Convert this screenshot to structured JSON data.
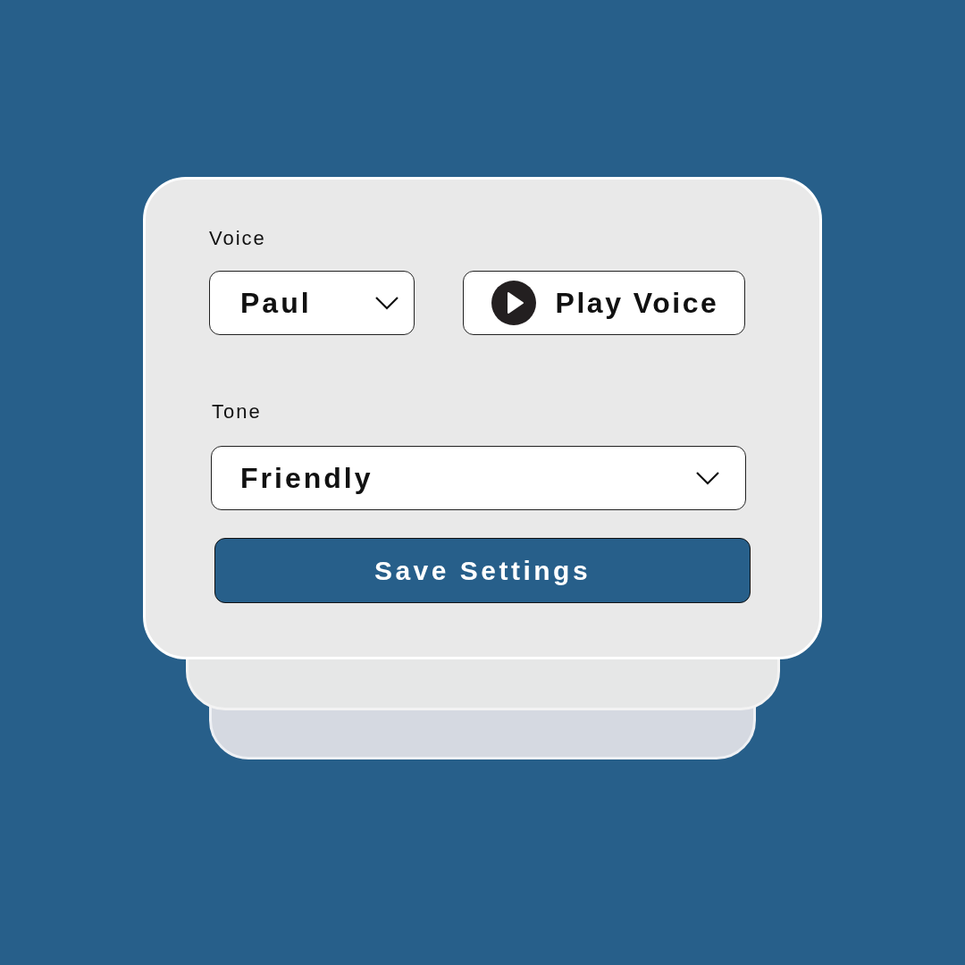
{
  "voice": {
    "label": "Voice",
    "value": "Paul"
  },
  "play_button": {
    "label": "Play Voice"
  },
  "tone": {
    "label": "Tone",
    "value": "Friendly"
  },
  "save_button": {
    "label": "Save Settings"
  }
}
